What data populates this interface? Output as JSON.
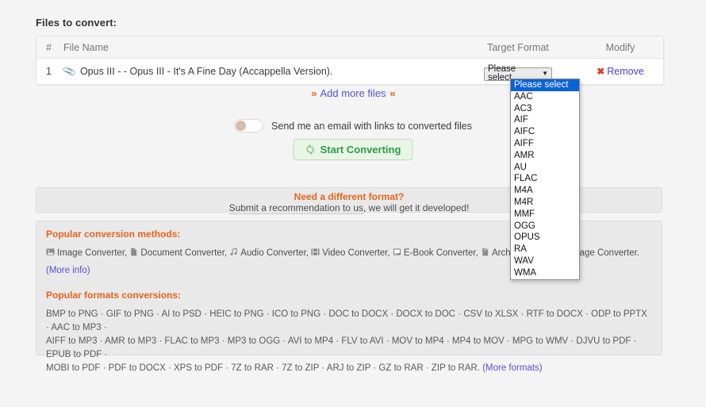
{
  "page": {
    "section_title": "Files to convert:",
    "background": "#f4f4f4"
  },
  "file_table": {
    "columns": {
      "number": "#",
      "file_name": "File Name",
      "target_format": "Target Format",
      "modify": "Modify"
    },
    "rows": [
      {
        "number": "1",
        "file_name": "Opus III - - Opus III - It's A Fine Day (Accappella Version).",
        "attachment_icon": "paperclip-icon",
        "target_format_value": "Please select",
        "remove_label": "Remove",
        "remove_icon": "red-x-icon"
      }
    ]
  },
  "format_dropdown": {
    "open": true,
    "selected": "Please select",
    "highlight_color": "#0a63d6",
    "options": [
      "Please select",
      "AAC",
      "AC3",
      "AIF",
      "AIFC",
      "AIFF",
      "AMR",
      "AU",
      "FLAC",
      "M4A",
      "M4R",
      "MMF",
      "OGG",
      "OPUS",
      "RA",
      "WAV",
      "WMA"
    ]
  },
  "add_more": {
    "left_chevron": "»",
    "label": "Add more files",
    "right_chevron": "«"
  },
  "email_option": {
    "label": "Send me an email with links to converted files",
    "enabled": false
  },
  "start_button": {
    "label": "Start Converting",
    "icon": "recycle-icon",
    "text_color": "#2f9b4a"
  },
  "need_format": {
    "title": "Need a different format?",
    "link_text": "Submit a recommendation to us",
    "rest_text": ", we will get it developed!"
  },
  "popular_methods": {
    "heading": "Popular conversion methods:",
    "items": [
      {
        "icon": "image-icon",
        "label": "Image Converter,"
      },
      {
        "icon": "document-icon",
        "label": "Document Converter,"
      },
      {
        "icon": "music-note-icon",
        "label": "Audio Converter,"
      },
      {
        "icon": "film-icon",
        "label": "Video Converter,"
      },
      {
        "icon": "book-icon",
        "label": "E-Book Converter,"
      },
      {
        "icon": "archive-icon",
        "label": "Archive Converter,"
      },
      {
        "icon": "image-icon",
        "label": "Image Converter."
      }
    ],
    "more_info": "(More info)"
  },
  "popular_formats": {
    "heading": "Popular formats conversions:",
    "lines": [
      "BMP to PNG · GIF to PNG · AI to PSD · HEIC to PNG · ICO to PNG · DOC to DOCX · DOCX to DOC · CSV to XLSX · RTF to DOCX · ODP to PPTX · AAC to MP3 ·",
      "AIFF to MP3 · AMR to MP3 · FLAC to MP3 · MP3 to OGG · AVI to MP4 · FLV to AVI · MOV to MP4 · MP4 to MOV · MPG to WMV · DJVU to PDF · EPUB to PDF ·",
      "MOBI to PDF · PDF to DOCX · XPS to PDF · 7Z to RAR · 7Z to ZIP · ARJ to ZIP · GZ to RAR · ZIP to RAR."
    ],
    "more_formats": "(More formats)"
  }
}
